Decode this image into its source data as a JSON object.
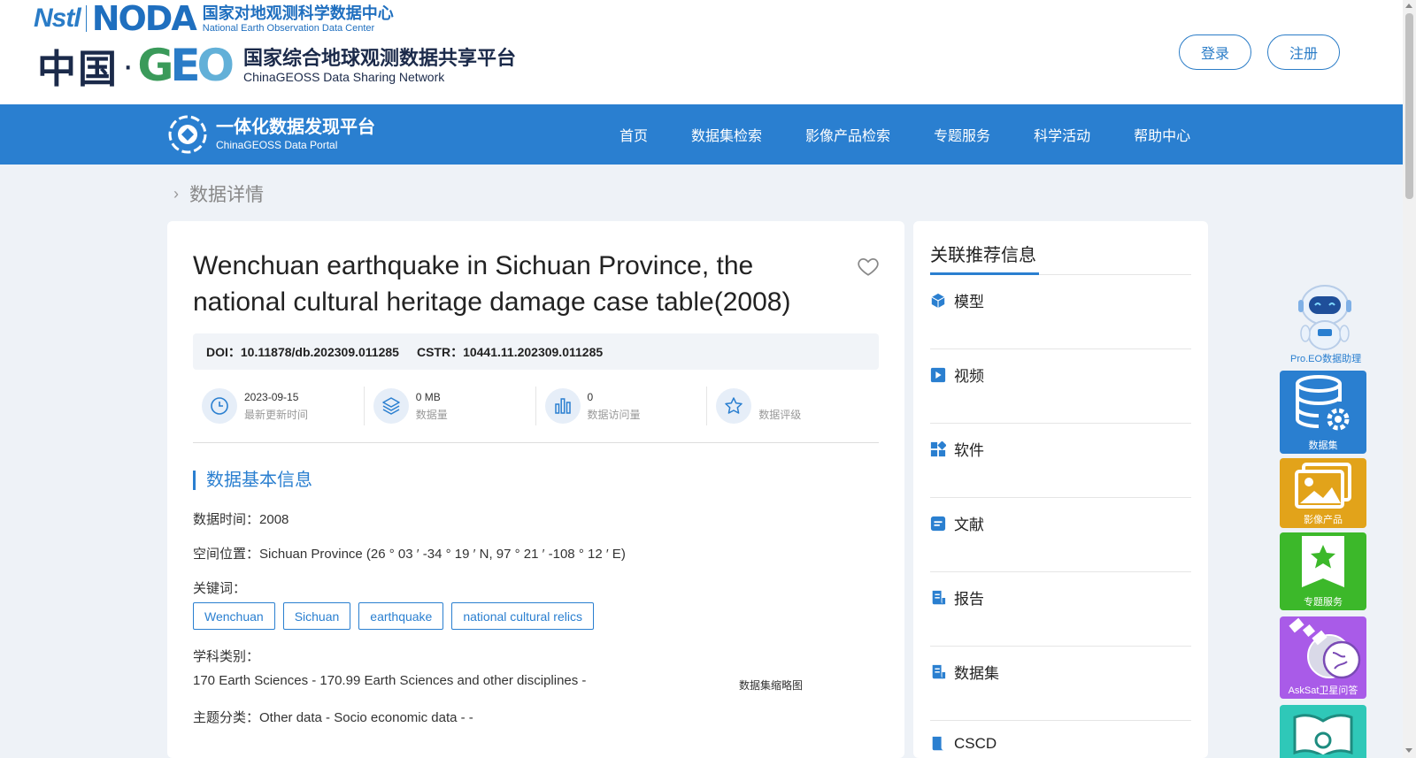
{
  "header": {
    "noda_logo_prefix": "Nstl",
    "noda_logo_word": "NODA",
    "noda_cn": "国家对地观测科学数据中心",
    "noda_en": "National Earth Observation Data Center",
    "geo_cn_prefix": "中国",
    "geo_dot": "·",
    "geo_title": "国家综合地球观测数据共享平台",
    "geo_en": "ChinaGEOSS Data Sharing Network",
    "login_label": "登录",
    "register_label": "注册"
  },
  "nav": {
    "portal_cn": "一体化数据发现平台",
    "portal_en": "ChinaGEOSS Data Portal",
    "items": [
      "首页",
      "数据集检索",
      "影像产品检索",
      "专题服务",
      "科学活动",
      "帮助中心"
    ]
  },
  "breadcrumb": {
    "current": "数据详情"
  },
  "dataset": {
    "title": "Wenchuan earthquake in Sichuan Province, the national cultural heritage damage case table(2008)",
    "doi_label": "DOI：",
    "doi": "10.11878/db.202309.011285",
    "cstr_label": "CSTR：",
    "cstr": "10441.11.202309.011285",
    "stats": [
      {
        "value": "2023-09-15",
        "label": "最新更新时间",
        "icon": "clock-icon"
      },
      {
        "value": "0 MB",
        "label": "数据量",
        "icon": "layers-icon"
      },
      {
        "value": "0",
        "label": "数据访问量",
        "icon": "bar-chart-icon"
      },
      {
        "value": "",
        "label": "数据评级",
        "icon": "star-icon"
      }
    ],
    "section_title": "数据基本信息",
    "time_label": "数据时间：",
    "time_value": "2008",
    "location_label": "空间位置：",
    "location_value": "Sichuan Province (26 ° 03 ′ -34 ° 19 ′ N, 97 ° 21 ′ -108 ° 12 ′ E)",
    "keywords_label": "关键词：",
    "keywords": [
      "Wenchuan",
      "Sichuan",
      "earthquake",
      "national cultural relics"
    ],
    "discipline_label": "学科类别：",
    "discipline_value": "170 Earth Sciences - 170.99 Earth Sciences and other disciplines -",
    "thumbnail_label": "数据集缩略图",
    "topic_label": "主题分类：",
    "topic_value": "Other data - Socio economic data - -"
  },
  "side": {
    "title": "关联推荐信息",
    "items": [
      {
        "label": "模型",
        "icon": "cube-icon"
      },
      {
        "label": "视频",
        "icon": "play-icon"
      },
      {
        "label": "软件",
        "icon": "apps-icon"
      },
      {
        "label": "文献",
        "icon": "document-icon"
      },
      {
        "label": "报告",
        "icon": "report-icon"
      },
      {
        "label": "数据集",
        "icon": "dataset-icon"
      },
      {
        "label": "CSCD",
        "icon": "cscd-icon"
      }
    ]
  },
  "float": {
    "robot_label": "Pro.EO数据助理",
    "buttons": [
      {
        "label": "数据集",
        "color": "#2a7fd0",
        "icon": "database-gear-icon"
      },
      {
        "label": "影像产品",
        "color": "#e2a31a",
        "icon": "image-icon"
      },
      {
        "label": "专题服务",
        "color": "#3cb82a",
        "icon": "bookmark-star-icon"
      },
      {
        "label": "AskSat卫星问答",
        "color": "#a95be8",
        "icon": "satellite-icon"
      },
      {
        "label": "",
        "color": "#2fc8b8",
        "icon": "book-icon"
      }
    ]
  },
  "colors": {
    "primary": "#2a7fd0",
    "background": "#eef2f7"
  }
}
